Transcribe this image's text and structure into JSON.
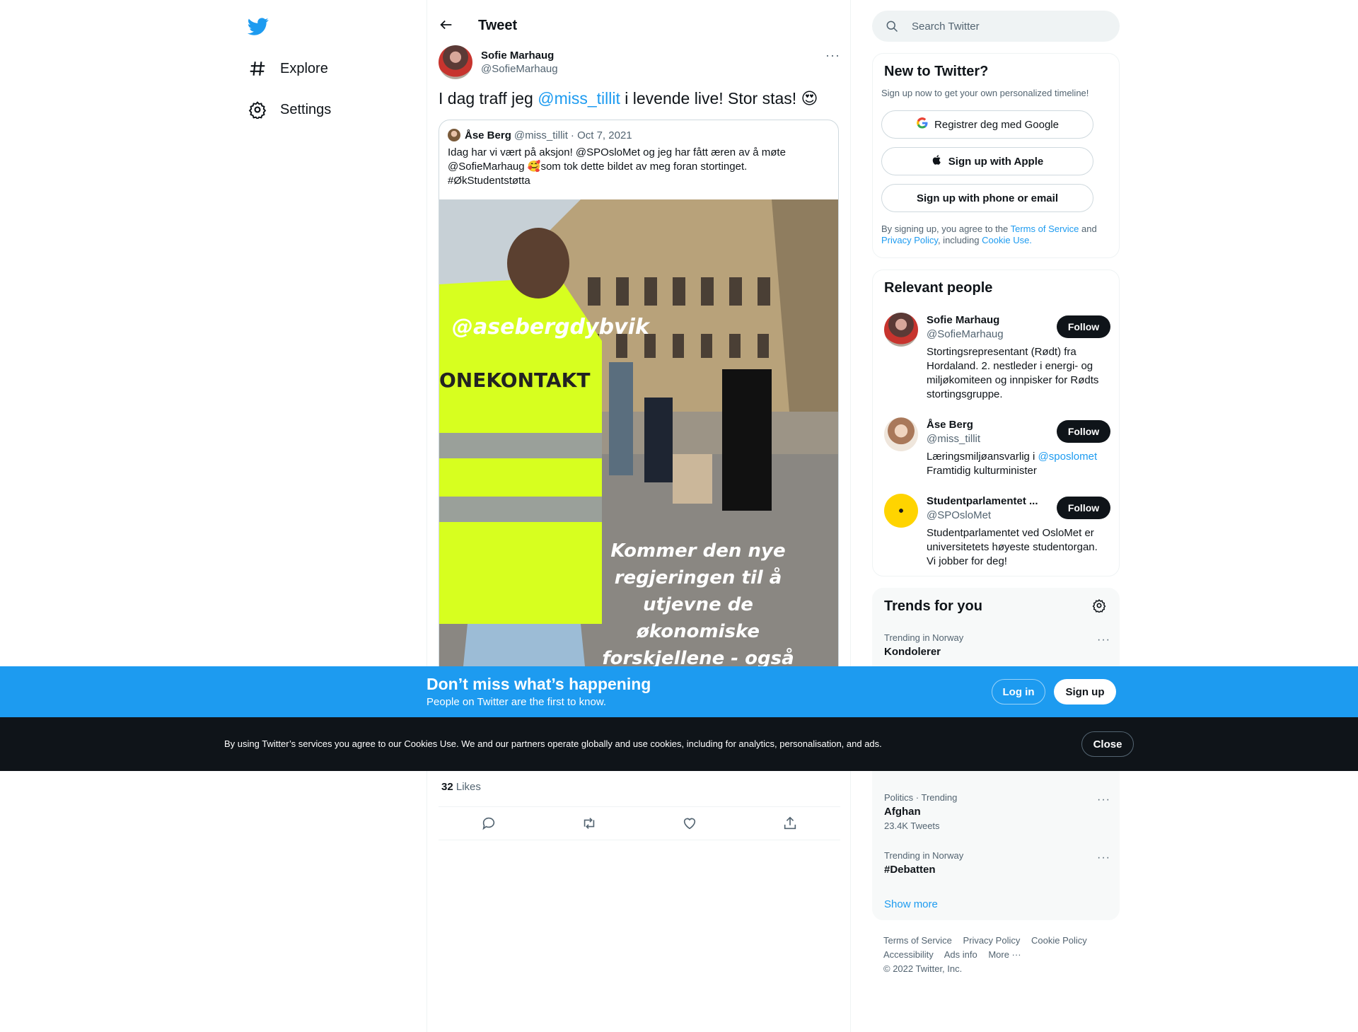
{
  "nav": {
    "explore_label": "Explore",
    "settings_label": "Settings"
  },
  "header": {
    "title": "Tweet"
  },
  "tweet": {
    "author_name": "Sofie Marhaug",
    "author_handle": "@SofieMarhaug",
    "text_before": "I dag traff jeg ",
    "mention": "@miss_tillit",
    "text_after": " i levende live! Stor stas! 😍",
    "likes_count": "32",
    "likes_label": "Likes"
  },
  "quote": {
    "name": "Åse Berg",
    "handle": "@miss_tillit",
    "date": "· Oct 7, 2021",
    "line1": "Idag har vi vært på aksjon! @SPOsloMet og jeg har fått æren av å møte",
    "line2": "@SofieMarhaug  🥰som tok dette bildet av meg foran stortinget.",
    "line3": "#ØkStudentstøtta",
    "image_vest_tag": "@asebergdybvik",
    "image_vest_text": "ONEKONTAKT",
    "image_caption_1": "Kommer den nye",
    "image_caption_2": "regjeringen til å",
    "image_caption_3": "utjevne de",
    "image_caption_4": "økonomiske",
    "image_caption_5": "forskjellene - også"
  },
  "search": {
    "placeholder": "Search Twitter"
  },
  "new_to_twitter": {
    "title": "New to Twitter?",
    "subtitle": "Sign up now to get your own personalized timeline!",
    "google_label": "Registrer deg med Google",
    "apple_label": "Sign up with Apple",
    "phone_label": "Sign up with phone or email",
    "legal_1": "By signing up, you agree to the ",
    "legal_tos": "Terms of Service",
    "legal_2": " and ",
    "legal_privacy": "Privacy Policy",
    "legal_3": ", including ",
    "legal_cookie": "Cookie Use."
  },
  "relevant_people": {
    "title": "Relevant people",
    "follow_label": "Follow",
    "people": [
      {
        "name": "Sofie Marhaug",
        "handle": "@SofieMarhaug",
        "bio": "Stortingsrepresentant (Rødt) fra Hordaland. 2. nestleder i energi- og miljøkomiteen og innpisker for Rødts stortingsgruppe."
      },
      {
        "name": "Åse Berg",
        "handle": "@miss_tillit",
        "bio_1": "Læringsmiljøansvarlig i ",
        "bio_link": "@sposlomet",
        "bio_2": "Framtidig kulturminister"
      },
      {
        "name": "Studentparlamentet ...",
        "handle": "@SPOsloMet",
        "bio": "Studentparlamentet ved OsloMet er universitetets høyeste studentorgan. Vi jobber for deg!"
      }
    ]
  },
  "trends": {
    "title": "Trends for you",
    "items": [
      {
        "meta": "Trending in Norway",
        "name": "Kondolerer"
      },
      {
        "meta": "Politics · Trending",
        "name": "Afghan",
        "count": "23.4K Tweets"
      },
      {
        "meta": "Trending in Norway",
        "name": "#Debatten"
      }
    ],
    "show_more": "Show more"
  },
  "footer": {
    "tos": "Terms of Service",
    "privacy": "Privacy Policy",
    "cookie": "Cookie Policy",
    "accessibility": "Accessibility",
    "ads": "Ads info",
    "more": "More ···",
    "copyright": "© 2022 Twitter, Inc."
  },
  "bottom_bar": {
    "title": "Don’t miss what’s happening",
    "subtitle": "People on Twitter are the first to know.",
    "login_label": "Log in",
    "signup_label": "Sign up"
  },
  "cookie_bar": {
    "text": "By using Twitter’s services you agree to our Cookies Use. We and our partners operate globally and use cookies, including for analytics, personalisation, and ads.",
    "close_label": "Close"
  },
  "colors": {
    "accent": "#1d9bf0",
    "text": "#0f1419",
    "muted": "#536471",
    "cookie_bg": "#0f1419"
  }
}
